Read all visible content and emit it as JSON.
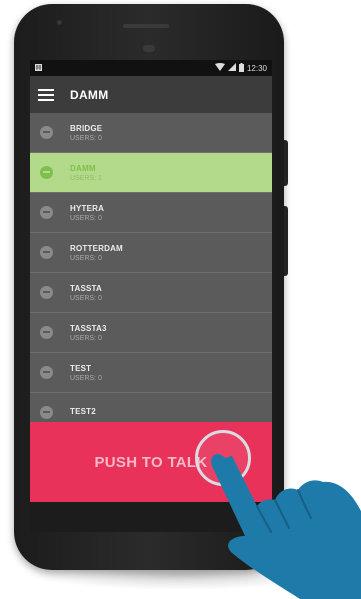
{
  "status_bar": {
    "time": "12:30"
  },
  "app_bar": {
    "title": "DAMM"
  },
  "channels": [
    {
      "name": "BRIDGE",
      "users": "USERS: 0",
      "active": false
    },
    {
      "name": "DAMM",
      "users": "USERS: 1",
      "active": true
    },
    {
      "name": "HYTERA",
      "users": "USERS: 0",
      "active": false
    },
    {
      "name": "ROTTERDAM",
      "users": "USERS: 0",
      "active": false
    },
    {
      "name": "TASSTA",
      "users": "USERS: 0",
      "active": false
    },
    {
      "name": "TASSTA3",
      "users": "USERS: 0",
      "active": false
    },
    {
      "name": "TEST",
      "users": "USERS: 0",
      "active": false
    },
    {
      "name": "TEST2",
      "users": "",
      "active": false
    }
  ],
  "ptt_button": {
    "label": "PUSH TO TALK"
  },
  "colors": {
    "accent_active": "#b3d98a",
    "ptt": "#e8325a",
    "hand": "#1e7aa8"
  },
  "icons": [
    "menu-icon",
    "wifi-icon",
    "signal-icon",
    "battery-icon",
    "channel-icon",
    "hand-icon"
  ]
}
